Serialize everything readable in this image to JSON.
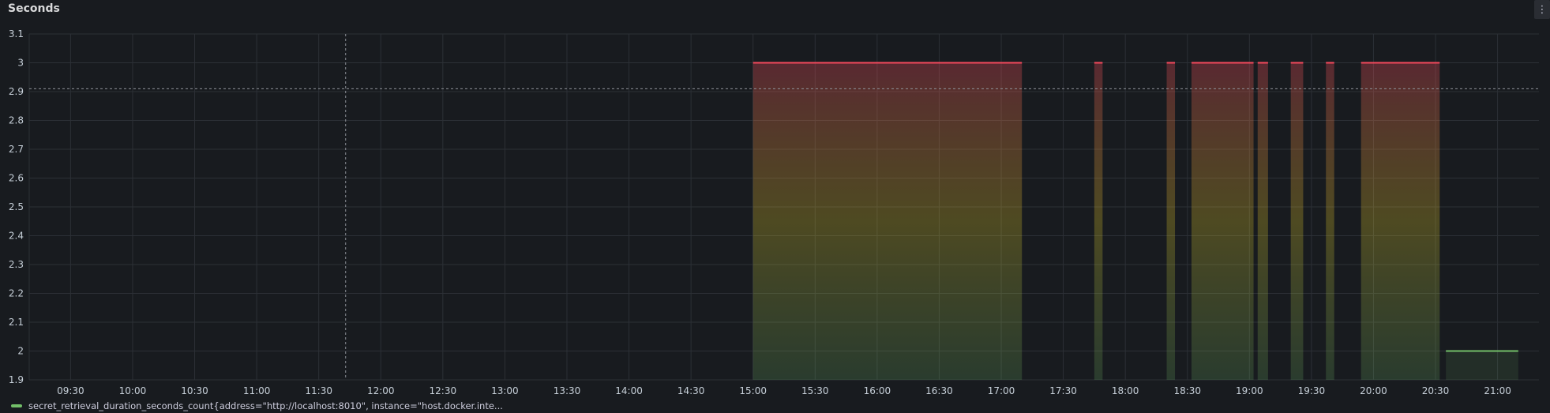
{
  "panel": {
    "title": "Seconds",
    "menu_icon": "kebab-vertical-icon"
  },
  "colors": {
    "background": "#181b1f",
    "grid": "#2c3036",
    "high_line": "#f2495c",
    "low_line": "#73bf69",
    "gradient_top": "#f2495c",
    "gradient_mid": "#fade2a",
    "gradient_bottom": "#73bf69"
  },
  "legend": {
    "series_label": "secret_retrieval_duration_seconds_count{address=\"http://localhost:8010\", instance=\"host.docker.inte..."
  },
  "chart_data": {
    "type": "area",
    "title": "Seconds",
    "xlabel": "",
    "ylabel": "",
    "ylim": [
      1.9,
      3.1
    ],
    "xlim": [
      "09:10",
      "21:20"
    ],
    "grid": true,
    "legend_position": "bottom-left",
    "y_ticks": [
      "3.1",
      "3",
      "2.9",
      "2.8",
      "2.7",
      "2.6",
      "2.5",
      "2.4",
      "2.3",
      "2.2",
      "2.1",
      "2",
      "1.9"
    ],
    "x_ticks": [
      "09:30",
      "10:00",
      "10:30",
      "11:00",
      "11:30",
      "12:00",
      "12:30",
      "13:00",
      "13:30",
      "14:00",
      "14:30",
      "15:00",
      "15:30",
      "16:00",
      "16:30",
      "17:00",
      "17:30",
      "18:00",
      "18:30",
      "19:00",
      "19:30",
      "20:00",
      "20:30",
      "21:00"
    ],
    "series": [
      {
        "name": "secret_retrieval_duration_seconds_count{address=\"http://localhost:8010\", instance=\"host.docker.inte...",
        "segments": [
          {
            "start": "15:00",
            "end": "17:10",
            "value": 3
          },
          {
            "start": "17:45",
            "end": "17:49",
            "value": 3
          },
          {
            "start": "18:20",
            "end": "18:24",
            "value": 3
          },
          {
            "start": "18:32",
            "end": "19:02",
            "value": 3
          },
          {
            "start": "19:04",
            "end": "19:09",
            "value": 3
          },
          {
            "start": "19:20",
            "end": "19:26",
            "value": 3
          },
          {
            "start": "19:37",
            "end": "19:41",
            "value": 3
          },
          {
            "start": "19:54",
            "end": "20:32",
            "value": 3
          },
          {
            "start": "20:35",
            "end": "21:10",
            "value": 2
          }
        ]
      }
    ],
    "threshold": 2.91,
    "crosshair_x": "11:43"
  }
}
